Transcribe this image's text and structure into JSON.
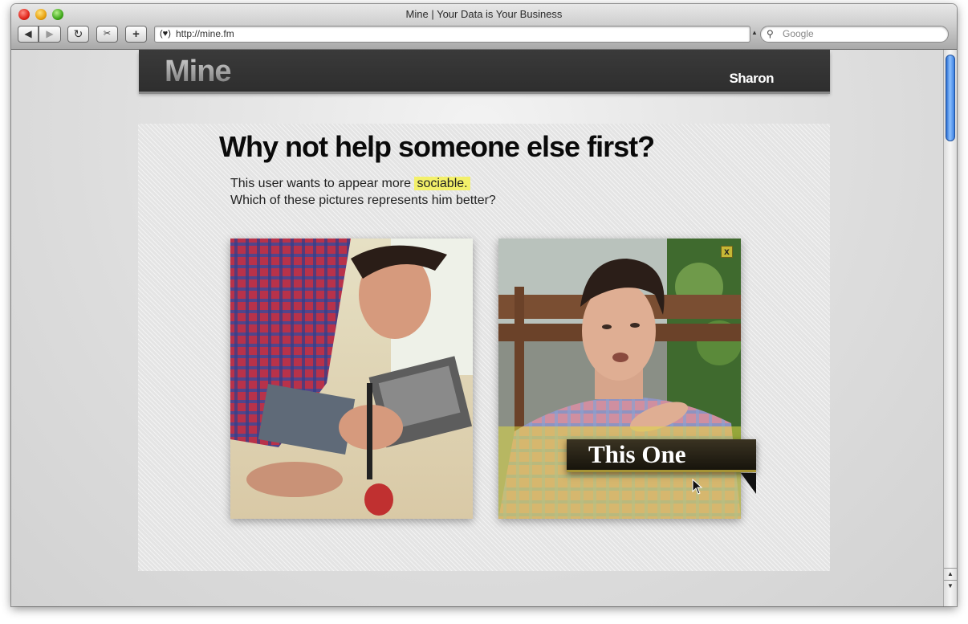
{
  "browser": {
    "window_title": "Mine | Your Data is Your Business",
    "url": "http://mine.fm",
    "search_placeholder": "Google",
    "toolbar": {
      "back_icon": "◀",
      "forward_icon": "▶",
      "reload_icon": "↻",
      "snip_icon": "✂",
      "add_bookmark_icon": "+"
    }
  },
  "site": {
    "logo": "Mine",
    "user_name": "Sharon"
  },
  "prompt": {
    "headline": "Why not help someone else first?",
    "line1_prefix": "This user wants to appear more ",
    "line1_highlight": "sociable.",
    "line2": "Which of these pictures represents him better?"
  },
  "choices": {
    "close_label": "x",
    "select_label": "This One"
  },
  "colors": {
    "highlight": "#f3f06a",
    "header_bg": "#333333",
    "label_accent": "#a69434"
  }
}
